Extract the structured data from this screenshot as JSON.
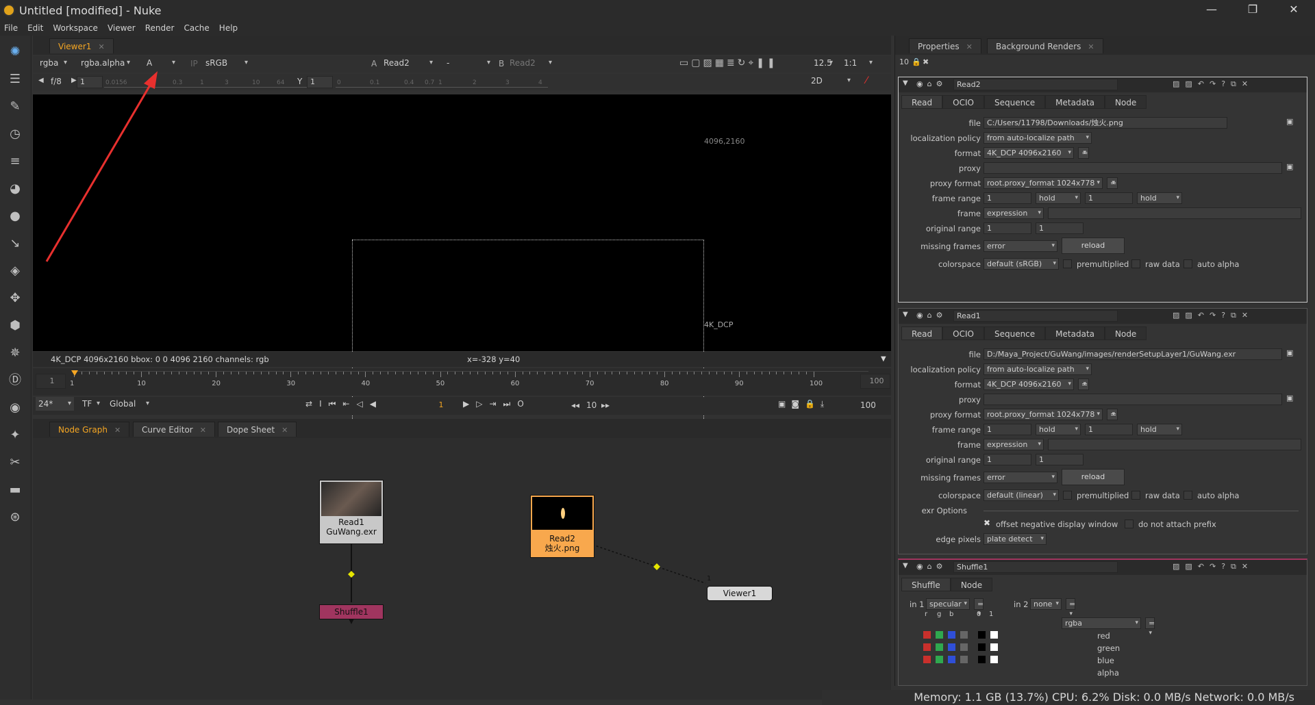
{
  "window": {
    "title": "Untitled [modified] - Nuke",
    "minimize": "—",
    "maximize": "❐",
    "close": "✕"
  },
  "menu": [
    "File",
    "Edit",
    "Workspace",
    "Viewer",
    "Render",
    "Cache",
    "Help"
  ],
  "viewer_tab": {
    "label": "Viewer1",
    "close": "✕"
  },
  "viewer_controls": {
    "channels": "rgba",
    "alpha": "rgba.alpha",
    "input": "A",
    "ip": "IP",
    "lut": "sRGB",
    "a_label": "A",
    "a_node": "Read2",
    "compare": "-",
    "b_label": "B",
    "b_node": "Read2",
    "zoom": "12.5",
    "ratio": "1:1"
  },
  "viewer_row2": {
    "fstop": "f/8",
    "gain": "1",
    "y_label": "Y",
    "gamma": "1",
    "mode": "2D",
    "gain_ticks": [
      "0.0156",
      "0.3",
      "1",
      "3",
      "10",
      "64"
    ],
    "gamma_ticks": [
      "0",
      "0.1",
      "0.4",
      "0.7",
      "1",
      "2",
      "3",
      "4"
    ]
  },
  "viewer_canvas": {
    "corner_top": "4096,2160",
    "corner_bottom": "4K_DCP"
  },
  "viewer_info": {
    "left": "4K_DCP 4096x2160  bbox: 0 0 4096 2160 channels: rgb",
    "coords": "x=-328 y=40"
  },
  "timeline": {
    "start": "1",
    "end": "100",
    "ticks": [
      "1",
      "10",
      "20",
      "30",
      "40",
      "50",
      "60",
      "70",
      "80",
      "90",
      "100"
    ],
    "fps": "24*",
    "tf": "TF",
    "global": "Global",
    "frame": "1",
    "step": "10",
    "end2": "100"
  },
  "bottom_tabs": [
    {
      "label": "Node Graph",
      "close": "✕"
    },
    {
      "label": "Curve Editor",
      "close": "✕"
    },
    {
      "label": "Dope Sheet",
      "close": "✕"
    }
  ],
  "nodes": {
    "read1": {
      "name": "Read1",
      "file": "GuWang.exr"
    },
    "read2": {
      "name": "Read2",
      "file": "烛火.png"
    },
    "shuffle": {
      "name": "Shuffle1"
    },
    "viewer": {
      "name": "Viewer1",
      "input": "1"
    }
  },
  "props_tabs": [
    {
      "label": "Properties",
      "close": "✕"
    },
    {
      "label": "Background Renders",
      "close": "✕"
    }
  ],
  "props_count": "10",
  "read2_panel": {
    "name": "Read2",
    "tabs": [
      "Read",
      "OCIO",
      "Sequence",
      "Metadata",
      "Node"
    ],
    "labels": {
      "file": "file",
      "loc": "localization policy",
      "format": "format",
      "proxy": "proxy",
      "proxy_format": "proxy format",
      "frame_range": "frame range",
      "frame": "frame",
      "original_range": "original range",
      "missing": "missing frames",
      "colorspace": "colorspace"
    },
    "file": "C:/Users/11798/Downloads/烛火.png",
    "loc_policy": "from auto-localize path",
    "format": "4K_DCP 4096x2160",
    "proxy_format": "root.proxy_format 1024x778",
    "frame_start": "1",
    "before": "hold",
    "frame_end": "1",
    "after": "hold",
    "frame_mode": "expression",
    "orig_start": "1",
    "orig_end": "1",
    "missing": "error",
    "reload": "reload",
    "colorspace": "default (sRGB)",
    "premult": "premultiplied",
    "raw": "raw data",
    "auto_alpha": "auto alpha",
    "eq": "="
  },
  "read1_panel": {
    "name": "Read1",
    "tabs": [
      "Read",
      "OCIO",
      "Sequence",
      "Metadata",
      "Node"
    ],
    "labels": {
      "file": "file",
      "loc": "localization policy",
      "format": "format",
      "proxy": "proxy",
      "proxy_format": "proxy format",
      "frame_range": "frame range",
      "frame": "frame",
      "original_range": "original range",
      "missing": "missing frames",
      "colorspace": "colorspace",
      "exr": "exr Options",
      "edge": "edge pixels"
    },
    "file": "D:/Maya_Project/GuWang/images/renderSetupLayer1/GuWang.exr",
    "loc_policy": "from auto-localize path",
    "format": "4K_DCP 4096x2160",
    "proxy_format": "root.proxy_format 1024x778",
    "frame_start": "1",
    "before": "hold",
    "frame_end": "1",
    "after": "hold",
    "frame_mode": "expression",
    "orig_start": "1",
    "orig_end": "1",
    "missing": "error",
    "reload": "reload",
    "colorspace": "default (linear)",
    "premult": "premultiplied",
    "raw": "raw data",
    "auto_alpha": "auto alpha",
    "offset": "offset negative display window",
    "no_prefix": "do not attach prefix",
    "edge": "plate detect",
    "eq": "="
  },
  "shuffle_panel": {
    "name": "Shuffle1",
    "tabs": [
      "Shuffle",
      "Node"
    ],
    "in1_label": "in 1",
    "in1": "specular",
    "in2_label": "in 2",
    "in2": "none",
    "out": "rgba",
    "eq": "=",
    "col_r": "r",
    "col_g": "g",
    "col_b": "b",
    "col_0": "0",
    "col_1": "1",
    "rows": [
      "red",
      "green",
      "blue",
      "alpha"
    ]
  },
  "status": "Memory: 1.1 GB (13.7%) CPU: 6.2% Disk: 0.0 MB/s Network: 0.0 MB/s",
  "colors": {
    "accent": "#f5a623",
    "read2_node": "#f8a84d",
    "shuffle_node": "#a0355f",
    "annotation": "#e8302e"
  }
}
